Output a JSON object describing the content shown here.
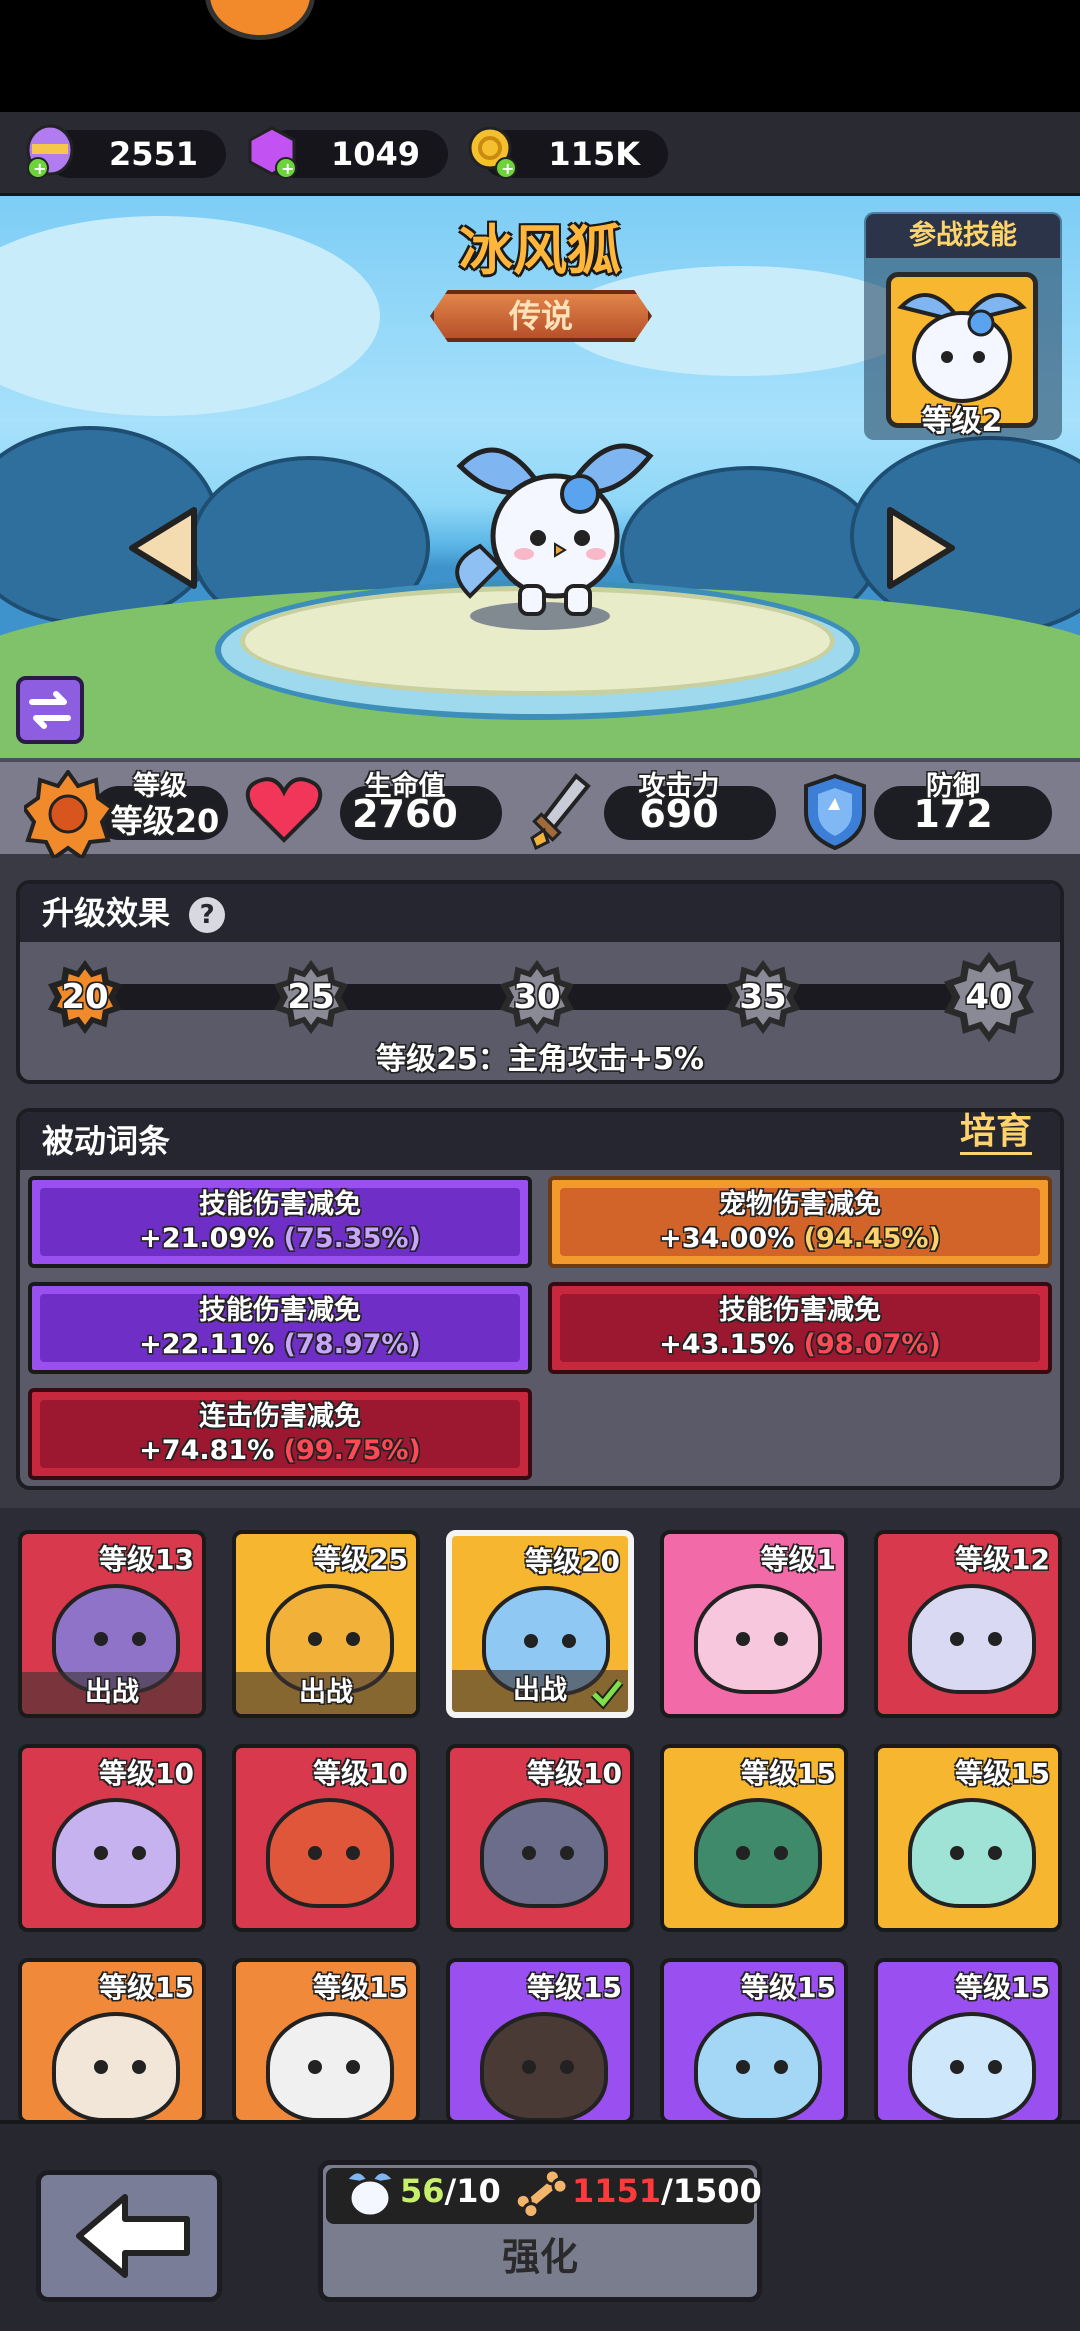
{
  "currency": [
    {
      "icon": "egg-icon",
      "value": "2551"
    },
    {
      "icon": "purple-gem-icon",
      "value": "1049"
    },
    {
      "icon": "gold-coin-icon",
      "value": "115K"
    }
  ],
  "pet": {
    "name": "冰风狐",
    "rarity": "传说"
  },
  "battle_skill": {
    "title": "参战技能",
    "level": "等级2"
  },
  "stats": {
    "level_label": "等级",
    "level_value": "等级20",
    "hp_label": "生命值",
    "hp_value": "2760",
    "atk_label": "攻击力",
    "atk_value": "690",
    "def_label": "防御",
    "def_value": "172"
  },
  "upgrade_effect": {
    "title": "升级效果",
    "help": "?",
    "milestones": [
      "20",
      "25",
      "30",
      "35",
      "40"
    ],
    "current": "20",
    "description": "等级25：主角攻击+5%"
  },
  "passive": {
    "title": "被动词条",
    "foster_label": "培育",
    "traits": [
      {
        "name": "技能伤害减免",
        "value": "+21.09%",
        "pct": "(75.35%)",
        "color": "purple"
      },
      {
        "name": "宠物伤害减免",
        "value": "+34.00%",
        "pct": "(94.45%)",
        "color": "orange"
      },
      {
        "name": "技能伤害减免",
        "value": "+22.11%",
        "pct": "(78.97%)",
        "color": "purple"
      },
      {
        "name": "技能伤害减免",
        "value": "+43.15%",
        "pct": "(98.07%)",
        "color": "red"
      },
      {
        "name": "连击伤害减免",
        "value": "+74.81%",
        "pct": "(99.75%)",
        "color": "red"
      }
    ]
  },
  "pets": [
    {
      "level": "等级13",
      "out": "出战",
      "bg": "red",
      "face": "#8f73c9"
    },
    {
      "level": "等级25",
      "out": "出战",
      "bg": "yellow",
      "face": "#f2b23a"
    },
    {
      "level": "等级20",
      "out": "出战",
      "bg": "yellow",
      "face": "#8fc9f3",
      "selected": true
    },
    {
      "level": "等级1",
      "out": "",
      "bg": "pink",
      "face": "#f7c7de"
    },
    {
      "level": "等级12",
      "out": "",
      "bg": "red",
      "face": "#d9d9f3"
    },
    {
      "level": "等级10",
      "out": "",
      "bg": "red",
      "face": "#c6b2ef"
    },
    {
      "level": "等级10",
      "out": "",
      "bg": "red",
      "face": "#e0563a"
    },
    {
      "level": "等级10",
      "out": "",
      "bg": "red",
      "face": "#6b6d8a"
    },
    {
      "level": "等级15",
      "out": "",
      "bg": "yellow",
      "face": "#3f8a6a"
    },
    {
      "level": "等级15",
      "out": "",
      "bg": "yellow",
      "face": "#9fe3d6"
    },
    {
      "level": "等级15",
      "out": "",
      "bg": "orange",
      "face": "#f2e6d8"
    },
    {
      "level": "等级15",
      "out": "",
      "bg": "orange",
      "face": "#f0f0f0"
    },
    {
      "level": "等级15",
      "out": "",
      "bg": "purple",
      "face": "#4a3a36"
    },
    {
      "level": "等级15",
      "out": "",
      "bg": "purple",
      "face": "#a3d7f5"
    },
    {
      "level": "等级15",
      "out": "",
      "bg": "purple",
      "face": "#cfe7fb"
    }
  ],
  "bottom": {
    "shards_have": "56",
    "shards_need": "/10",
    "bones_have": "1151",
    "bones_need": "/1500",
    "upgrade_label": "强化"
  }
}
